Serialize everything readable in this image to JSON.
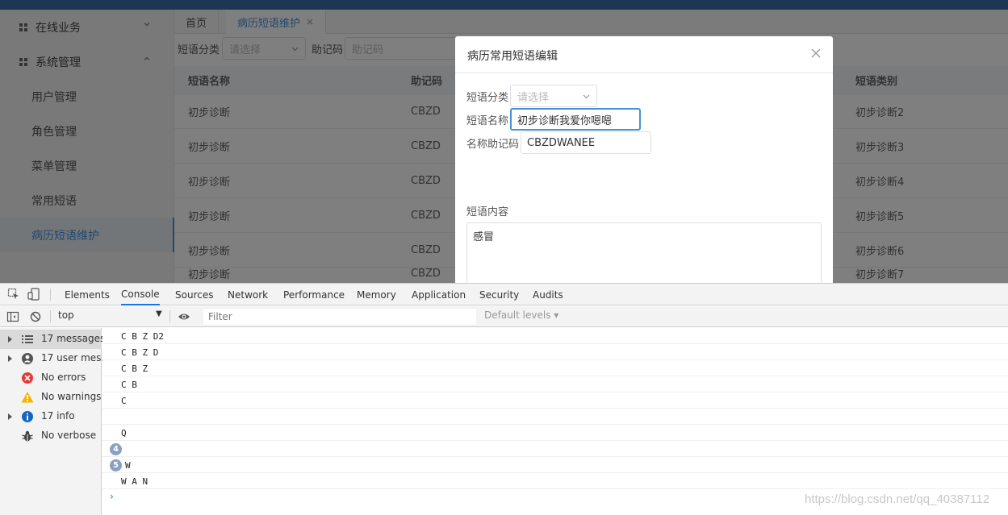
{
  "sidebar": {
    "groups": [
      {
        "label": "在线业务",
        "expanded": false
      },
      {
        "label": "系统管理",
        "expanded": true
      }
    ],
    "items": [
      "用户管理",
      "角色管理",
      "菜单管理",
      "常用短语",
      "病历短语维护"
    ],
    "active_item": "病历短语维护"
  },
  "tabs": [
    {
      "label": "首页",
      "active": false
    },
    {
      "label": "病历短语维护",
      "active": true,
      "close": "×"
    }
  ],
  "search": {
    "category_label": "短语分类",
    "category_placeholder": "请选择",
    "mnemonic_label": "助记码",
    "mnemonic_placeholder": "助记码"
  },
  "table": {
    "columns": [
      "短语名称",
      "助记码",
      "短语类别"
    ],
    "rows": [
      {
        "name": "初步诊断",
        "code": "CBZD",
        "type": "初步诊断2"
      },
      {
        "name": "初步诊断",
        "code": "CBZD",
        "type": "初步诊断3"
      },
      {
        "name": "初步诊断",
        "code": "CBZD",
        "type": "初步诊断4"
      },
      {
        "name": "初步诊断",
        "code": "CBZD",
        "type": "初步诊断5"
      },
      {
        "name": "初步诊断",
        "code": "CBZD",
        "type": "初步诊断6"
      },
      {
        "name": "初步诊断",
        "code": "CBZD",
        "type": "初步诊断7"
      }
    ]
  },
  "dialog": {
    "title": "病历常用短语编辑",
    "category_label": "短语分类",
    "category_placeholder": "请选择",
    "name_label": "短语名称",
    "name_value": "初步诊断我爱你嗯嗯",
    "mnemonic_label": "名称助记码",
    "mnemonic_value": "CBZDWANEE",
    "content_label": "短语内容",
    "content_value": "感冒"
  },
  "devtools": {
    "tabs": [
      "Elements",
      "Console",
      "Sources",
      "Network",
      "Performance",
      "Memory",
      "Application",
      "Security",
      "Audits"
    ],
    "active_tab": "Console",
    "context": "top",
    "filter_placeholder": "Filter",
    "levels": "Default levels ▾",
    "sidebar": [
      {
        "label": "17 messages",
        "icon": "list-icon",
        "expandable": true,
        "selected": true
      },
      {
        "label": "17 user mes...",
        "icon": "user-icon",
        "expandable": true,
        "selected": false
      },
      {
        "label": "No errors",
        "icon": "error-icon",
        "expandable": false,
        "selected": false
      },
      {
        "label": "No warnings",
        "icon": "warning-icon",
        "expandable": false,
        "selected": false
      },
      {
        "label": "17 info",
        "icon": "info-icon",
        "expandable": true,
        "selected": false
      },
      {
        "label": "No verbose",
        "icon": "bug-icon",
        "expandable": false,
        "selected": false
      }
    ],
    "log": [
      {
        "text": "C B Z D2",
        "badge": ""
      },
      {
        "text": "C B Z D",
        "badge": ""
      },
      {
        "text": "C B Z",
        "badge": ""
      },
      {
        "text": "C B",
        "badge": ""
      },
      {
        "text": "C",
        "badge": ""
      },
      {
        "text": "",
        "badge": ""
      },
      {
        "text": "Q",
        "badge": ""
      },
      {
        "text": "",
        "badge": "4"
      },
      {
        "text": "W",
        "badge": "5"
      },
      {
        "text": "W A N",
        "badge": ""
      }
    ],
    "prompt": "›"
  },
  "watermark": "https://blog.csdn.net/qq_40387112",
  "colors": {
    "accent": "#4a8fd6",
    "topbar": "#3b6ea5",
    "devtools_accent": "#1a73e8"
  }
}
